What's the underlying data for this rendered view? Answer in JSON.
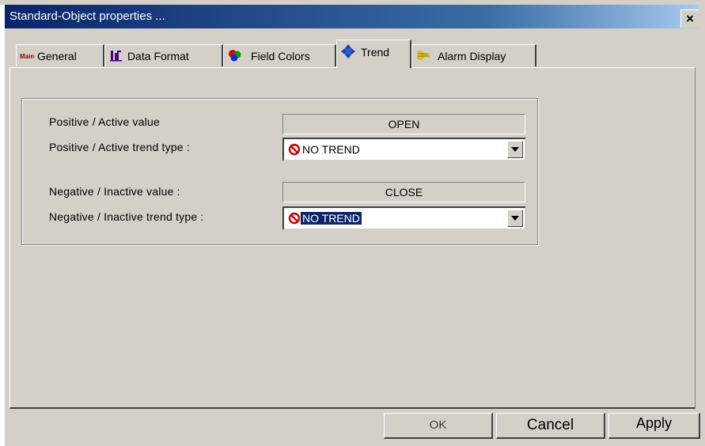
{
  "window": {
    "title": "Standard-Object properties ...",
    "close_label": "×"
  },
  "tabs": [
    {
      "label": "General",
      "icon": "main-badge-icon",
      "icon_text": "Main",
      "active": false
    },
    {
      "label": "Data Format",
      "icon": "data-format-icon",
      "active": false
    },
    {
      "label": "Field Colors",
      "icon": "field-colors-icon",
      "active": false
    },
    {
      "label": "Trend",
      "icon": "trend-icon",
      "active": true
    },
    {
      "label": "Alarm Display",
      "icon": "alarm-display-icon",
      "active": false
    }
  ],
  "trend": {
    "positive_value_label": "Positive / Active value",
    "positive_value": "OPEN",
    "positive_trend_label": "Positive / Active trend type :",
    "positive_trend_value": "NO TREND",
    "negative_value_label": "Negative / Inactive value :",
    "negative_value": "CLOSE",
    "negative_trend_label": "Negative / Inactive trend type :",
    "negative_trend_value": "NO TREND"
  },
  "buttons": {
    "ok": "OK",
    "cancel": "Cancel",
    "apply": "Apply"
  },
  "colors": {
    "title_bar": "#0a246a",
    "no_trend_icon": "#cc0000",
    "selection": "#0a246a"
  }
}
